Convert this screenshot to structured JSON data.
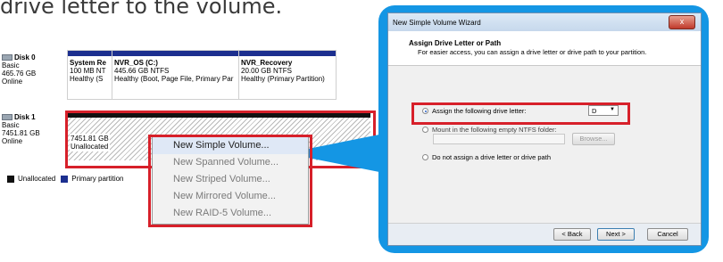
{
  "caption": "drive letter to the volume.",
  "disk_management": {
    "disk0": {
      "name": "Disk 0",
      "type": "Basic",
      "size": "465.76 GB",
      "status": "Online",
      "partitions": [
        {
          "name": "System Re",
          "size": "100 MB NT",
          "status": "Healthy (S​"
        },
        {
          "name": "NVR_OS  (C:)",
          "size": "445.66 GB NTFS",
          "status": "Healthy (Boot, Page File, Primary Par"
        },
        {
          "name": "NVR_Recovery",
          "size": "20.00 GB NTFS",
          "status": "Healthy (Primary Partition)"
        }
      ]
    },
    "disk1": {
      "name": "Disk 1",
      "type": "Basic",
      "size": "7451.81 GB",
      "status": "Online",
      "unallocated_size": "7451.81 GB",
      "unallocated_label": "Unallocated"
    },
    "legend": {
      "unallocated": "Unallocated",
      "primary": "Primary partition"
    },
    "colors": {
      "primary_bar": "#1c2f8f",
      "unallocated_bar": "#111111",
      "highlight": "#d7202a",
      "callout": "#1496e4"
    }
  },
  "context_menu": {
    "items": [
      {
        "label": "New Simple Volume..."
      },
      {
        "label": "New Spanned Volume..."
      },
      {
        "label": "New Striped Volume..."
      },
      {
        "label": "New Mirrored Volume..."
      },
      {
        "label": "New RAID-5 Volume..."
      }
    ]
  },
  "wizard": {
    "title": "New Simple Volume Wizard",
    "close_symbol": "x",
    "heading": "Assign Drive Letter or Path",
    "subheading": "For easier access, you can assign a drive letter or drive path to your partition.",
    "option_assign": "Assign the following drive letter:",
    "drive_letter": "D",
    "option_mount": "Mount in the following empty NTFS folder:",
    "browse": "Browse...",
    "option_none": "Do not assign a drive letter or drive path",
    "back": "< Back",
    "next": "Next >",
    "cancel": "Cancel"
  }
}
